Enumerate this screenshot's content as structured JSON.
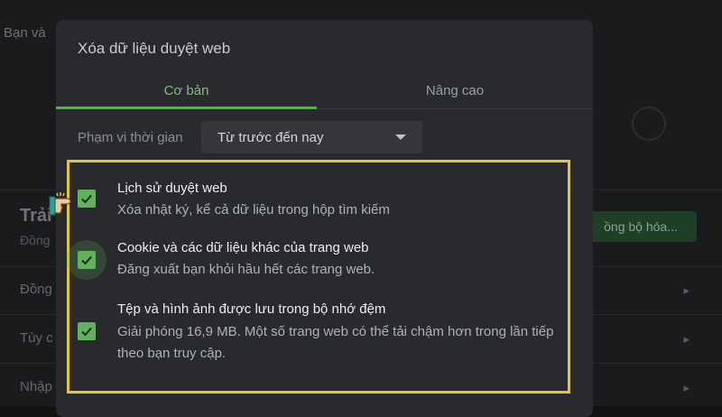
{
  "background": {
    "top_text": "Bạn và",
    "section_title": "Trải",
    "section_sub": "Đồng",
    "rows": [
      "Đồng",
      "Tùy c",
      "Nhập"
    ],
    "sync_button": "ồng bộ hóa..."
  },
  "dialog": {
    "title": "Xóa dữ liệu duyệt web",
    "tabs": [
      {
        "label": "Cơ bản",
        "active": true
      },
      {
        "label": "Nâng cao",
        "active": false
      }
    ],
    "time_range": {
      "label": "Phạm vi thời gian",
      "value": "Từ trước đến nay"
    },
    "options": [
      {
        "title": "Lịch sử duyệt web",
        "description": "Xóa nhật ký, kể cả dữ liệu trong hộp tìm kiếm",
        "checked": true
      },
      {
        "title": "Cookie và các dữ liệu khác của trang web",
        "description": "Đăng xuất bạn khỏi hầu hết các trang web.",
        "checked": true
      },
      {
        "title": "Tệp và hình ảnh được lưu trong bộ nhớ đệm",
        "description": "Giải phóng 16,9 MB. Một số trang web có thể tải chậm hơn trong lần tiếp theo bạn truy cập.",
        "checked": true
      }
    ]
  },
  "colors": {
    "accent": "#5fb35b",
    "highlight": "#e5c72b",
    "dialog_bg": "#292a2d"
  },
  "icons": [
    "checkmark-icon",
    "dropdown-arrow-icon",
    "pointing-hand-icon",
    "chevron-right-icon"
  ]
}
